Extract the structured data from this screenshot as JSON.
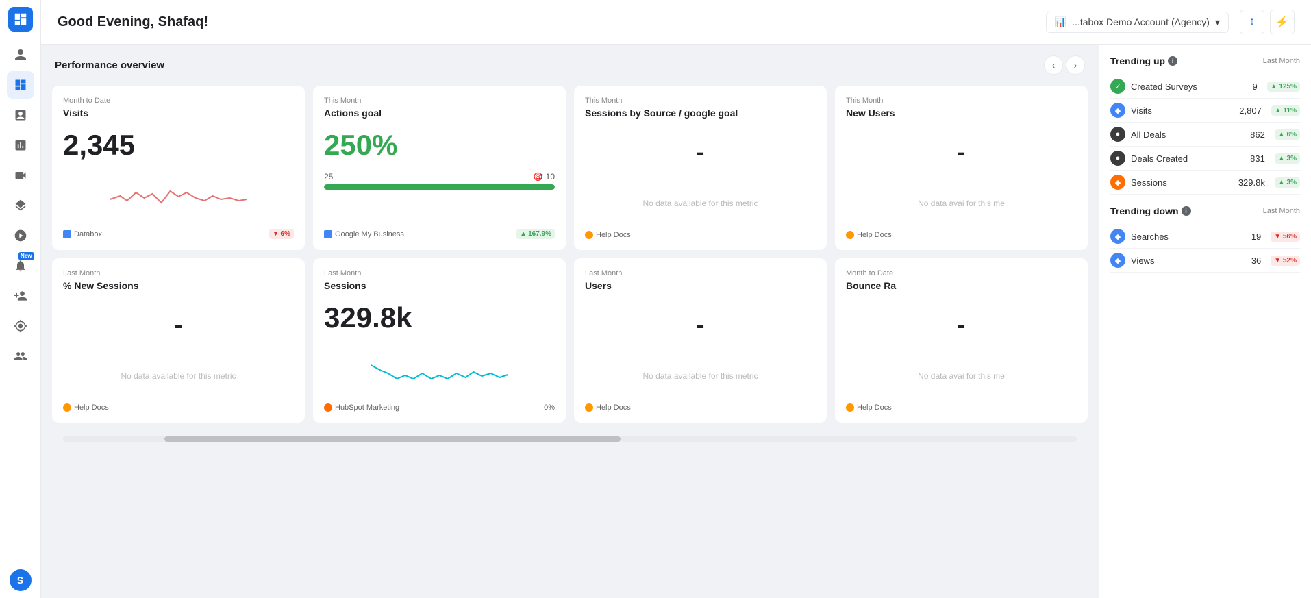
{
  "app": {
    "logo": "M",
    "title": "Good Evening, Shafaq!"
  },
  "account_selector": {
    "label": "...tabox Demo Account (Agency)",
    "icon": "📊"
  },
  "header_icons": {
    "sort_icon": "↕",
    "pulse_icon": "⚡"
  },
  "sidebar": {
    "items": [
      {
        "id": "home",
        "icon": "home",
        "active": false
      },
      {
        "id": "dashboard",
        "icon": "dashboard",
        "active": true
      },
      {
        "id": "numbers",
        "icon": "numbers",
        "active": false
      },
      {
        "id": "chart",
        "icon": "chart",
        "active": false
      },
      {
        "id": "video",
        "icon": "video",
        "active": false
      },
      {
        "id": "layers",
        "icon": "layers",
        "active": false
      },
      {
        "id": "target",
        "icon": "target",
        "active": false
      },
      {
        "id": "bell",
        "icon": "bell",
        "active": false,
        "badge": "New"
      },
      {
        "id": "person-new",
        "icon": "person-new",
        "active": false
      },
      {
        "id": "settings",
        "icon": "settings",
        "active": false
      },
      {
        "id": "people",
        "icon": "people",
        "active": false
      }
    ],
    "avatar_letter": "S"
  },
  "performance_overview": {
    "title": "Performance overview",
    "cards_row1": [
      {
        "period": "Month to Date",
        "title": "Visits",
        "value": "2,345",
        "has_sparkline": true,
        "sparkline_color": "#e57373",
        "source_icon_color": "#4285f4",
        "source": "Databox",
        "badge_type": "down",
        "badge_value": "6%"
      },
      {
        "period": "This Month",
        "title": "Actions goal",
        "value": "250%",
        "value_color": "green",
        "has_progress": true,
        "progress_current": 25,
        "progress_target": 10,
        "progress_pct": 100,
        "source_icon_color": "#4285f4",
        "source": "Google My Business",
        "badge_type": "up",
        "badge_value": "167.9%"
      },
      {
        "period": "This Month",
        "title": "Sessions by Source / google goal",
        "value": "-",
        "no_data": true,
        "no_data_text": "No data available for this metric",
        "source_icon_color": "#ff9800",
        "source": "Help Docs",
        "badge_type": "none"
      },
      {
        "period": "This Month",
        "title": "New Users",
        "value": "-",
        "no_data": true,
        "no_data_text": "No data avai for this me",
        "source_icon_color": "#ff9800",
        "source": "Help Docs",
        "badge_type": "none"
      }
    ],
    "cards_row2": [
      {
        "period": "Last Month",
        "title": "% New Sessions",
        "value": "-",
        "no_data": true,
        "no_data_text": "No data available for this metric",
        "source_icon_color": "#ff9800",
        "source": "Help Docs",
        "badge_type": "none"
      },
      {
        "period": "Last Month",
        "title": "Sessions",
        "value": "329.8k",
        "has_sparkline": true,
        "sparkline_color": "#00bcd4",
        "source_icon_color": "#ff6d00",
        "source": "HubSpot Marketing",
        "badge_type": "flat",
        "badge_value": "0%"
      },
      {
        "period": "Last Month",
        "title": "Users",
        "value": "-",
        "no_data": true,
        "no_data_text": "No data available for this metric",
        "source_icon_color": "#ff9800",
        "source": "Help Docs",
        "badge_type": "none"
      },
      {
        "period": "Month to Date",
        "title": "Bounce Ra",
        "value": "-",
        "no_data": true,
        "no_data_text": "No data avai for this me",
        "source_icon_color": "#ff9800",
        "source": "Help Docs",
        "badge_type": "none"
      }
    ]
  },
  "trending_up": {
    "title": "Trending up",
    "last_month_label": "Last Month",
    "items": [
      {
        "icon": "✓",
        "icon_bg": "green-bg",
        "name": "Created Surveys",
        "value": "9",
        "badge": "125%",
        "badge_type": "up"
      },
      {
        "icon": "◆",
        "icon_bg": "blue-bg",
        "name": "Visits",
        "value": "2,807",
        "badge": "11%",
        "badge_type": "up"
      },
      {
        "icon": "●",
        "icon_bg": "dark-bg",
        "name": "All Deals",
        "value": "862",
        "badge": "6%",
        "badge_type": "up"
      },
      {
        "icon": "●",
        "icon_bg": "dark-bg",
        "name": "Deals Created",
        "value": "831",
        "badge": "3%",
        "badge_type": "up"
      },
      {
        "icon": "◆",
        "icon_bg": "orange-bg",
        "name": "Sessions",
        "value": "329.8k",
        "badge": "3%",
        "badge_type": "up"
      }
    ]
  },
  "trending_down": {
    "title": "Trending down",
    "last_month_label": "Last Month",
    "items": [
      {
        "icon": "◆",
        "icon_bg": "blue-bg",
        "name": "Searches",
        "value": "19",
        "badge": "56%",
        "badge_type": "down"
      },
      {
        "icon": "◆",
        "icon_bg": "blue-bg",
        "name": "Views",
        "value": "36",
        "badge": "52%",
        "badge_type": "down"
      }
    ]
  }
}
